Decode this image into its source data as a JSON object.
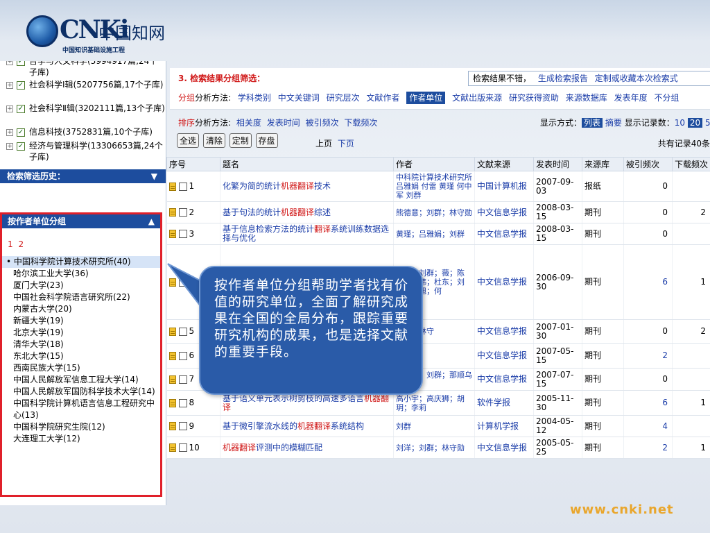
{
  "logo": {
    "brand": "CNKi",
    "zh": "中国知网",
    "sub": "中国知识基础设施工程"
  },
  "sidebar": {
    "db_items": [
      {
        "label": "哲学与人文科学(3994917篇,24个子库)"
      },
      {
        "label": "社会科学Ⅰ辑(5207756篇,17个子库)"
      },
      {
        "label": "社会科学Ⅱ辑(3202111篇,13个子库)"
      },
      {
        "label": "信息科技(3752831篇,10个子库)"
      },
      {
        "label": "经济与管理科学(13306653篇,24个子库)"
      }
    ],
    "history_label": "检索筛选历史：",
    "group_label": "按作者单位分组",
    "pages": [
      "1",
      "2"
    ],
    "orgs": [
      "• 中国科学院计算技术研究所(40)",
      "哈尔滨工业大学(36)",
      "厦门大学(23)",
      "中国社会科学院语言研究所(22)",
      "内蒙古大学(20)",
      "新疆大学(19)",
      "北京大学(19)",
      "清华大学(18)",
      "东北大学(15)",
      "西南民族大学(15)",
      "中国人民解放军信息工程大学(14)",
      "中国人民解放军国防科学技术大学(14)",
      "中国科学院计算机语言信息工程研究中",
      "心(13)",
      "中国科学院研究生院(12)",
      "大连理工大学(12)"
    ]
  },
  "section3": {
    "title": "3. 检索结果分组筛选：",
    "msg_prefix": "检索结果不错，",
    "msg_link1": "生成检索报告",
    "msg_link2": "定制或收藏本次检索式",
    "group_prefix_red": "分组",
    "group_prefix": "分析方法:",
    "group_options": [
      "学科类别",
      "中文关键词",
      "研究层次",
      "文献作者"
    ],
    "group_active": "作者单位",
    "group_options2": [
      "文献出版来源",
      "研究获得资助",
      "来源数据库",
      "发表年度",
      "不分组"
    ]
  },
  "sort": {
    "prefix_red": "排序",
    "prefix": "分析方法:",
    "options": [
      "相关度",
      "发表时间",
      "被引频次",
      "下载频次"
    ]
  },
  "display": {
    "label": "显示方式：",
    "list": "列表",
    "abstract": "摘要",
    "count_label": "显示记录数：",
    "counts": [
      "10",
      "20",
      "5"
    ]
  },
  "buttons": [
    "全选",
    "清除",
    "定制",
    "存盘"
  ],
  "pager": {
    "prev": "上页",
    "next": "下页"
  },
  "total": "共有记录40条",
  "table": {
    "headers": [
      "序号",
      "题名",
      "作者",
      "文献来源",
      "发表时间",
      "来源库",
      "被引频次",
      "下载频次"
    ],
    "rows": [
      {
        "no": "1",
        "title_pre": "化繁为简的统计",
        "title_kw": "机器翻译",
        "title_post": "技术",
        "author": "中科院计算技术研究所 吕雅娟 付雷 黄瑾 何中军 刘群",
        "source": "中国计算机报",
        "date": "2007-09-03",
        "db": "报纸",
        "cited": "0",
        "downloads": ""
      },
      {
        "no": "2",
        "title_pre": "基于句法的统计",
        "title_kw": "机器翻译",
        "title_post": "综述",
        "author": "熊德意；刘群；林守勋",
        "source": "中文信息学报",
        "date": "2008-03-15",
        "db": "期刊",
        "cited": "0",
        "downloads": "2"
      },
      {
        "no": "3",
        "title_pre": "基于信息检索方法的统计",
        "title_kw": "翻译",
        "title_post": "系统训练数据选择与优化",
        "author": "黄瑾；吕雅娟；刘群",
        "source": "中文信息学报",
        "date": "2008-03-15",
        "db": "期刊",
        "cited": "0",
        "downloads": ""
      },
      {
        "no": "4",
        "title_pre": "",
        "title_kw": "",
        "title_post": "",
        "author": "晓东；刘群；薇；陈振；魏玮；杜东；刘洋；宏旭；何",
        "source": "中文信息学报",
        "date": "2006-09-30",
        "db": "期刊",
        "cited": "6",
        "downloads": "1"
      },
      {
        "no": "5",
        "title_pre": "",
        "title_kw": "",
        "title_post": "",
        "author": "刘群；林守",
        "source": "中文信息学报",
        "date": "2007-01-30",
        "db": "期刊",
        "cited": "0",
        "downloads": "2"
      },
      {
        "no": "6",
        "title_pre": "",
        "title_kw": "",
        "title_post": "",
        "author": "群",
        "source": "中文信息学报",
        "date": "2007-05-15",
        "db": "期刊",
        "cited": "2",
        "downloads": ""
      },
      {
        "no": "7",
        "title_pre": "基于实例的汉蒙",
        "title_kw": "机器翻译",
        "title_post": "",
        "author": "侯宏旭；刘群；那顺乌日图",
        "source": "中文信息学报",
        "date": "2007-07-15",
        "db": "期刊",
        "cited": "0",
        "downloads": ""
      },
      {
        "no": "8",
        "title_pre": "基于语义单元表示树剪枝的高速多语言",
        "title_kw": "机器翻译",
        "title_post": "",
        "author": "高小宇；高庆狮；胡玥；李莉",
        "source": "软件学报",
        "date": "2005-11-30",
        "db": "期刊",
        "cited": "6",
        "downloads": "1"
      },
      {
        "no": "9",
        "title_pre": "基于微引擎流水线的",
        "title_kw": "机器翻译",
        "title_post": "系统结构",
        "author": "刘群",
        "source": "计算机学报",
        "date": "2004-05-12",
        "db": "期刊",
        "cited": "4",
        "downloads": ""
      },
      {
        "no": "10",
        "title_pre": "",
        "title_kw": "机器翻译",
        "title_post": "评测中的模糊匹配",
        "author": "刘洋；刘群；林守勋",
        "source": "中文信息学报",
        "date": "2005-05-25",
        "db": "期刊",
        "cited": "2",
        "downloads": "1"
      }
    ]
  },
  "callout": {
    "text": "按作者单位分组帮助学者找有价值的研究单位，全面了解研究成果在全国的全局分布，跟踪重要研究机构的成果，也是选择文献的重要手段。"
  },
  "footer": {
    "url": "www.cnki.net"
  }
}
